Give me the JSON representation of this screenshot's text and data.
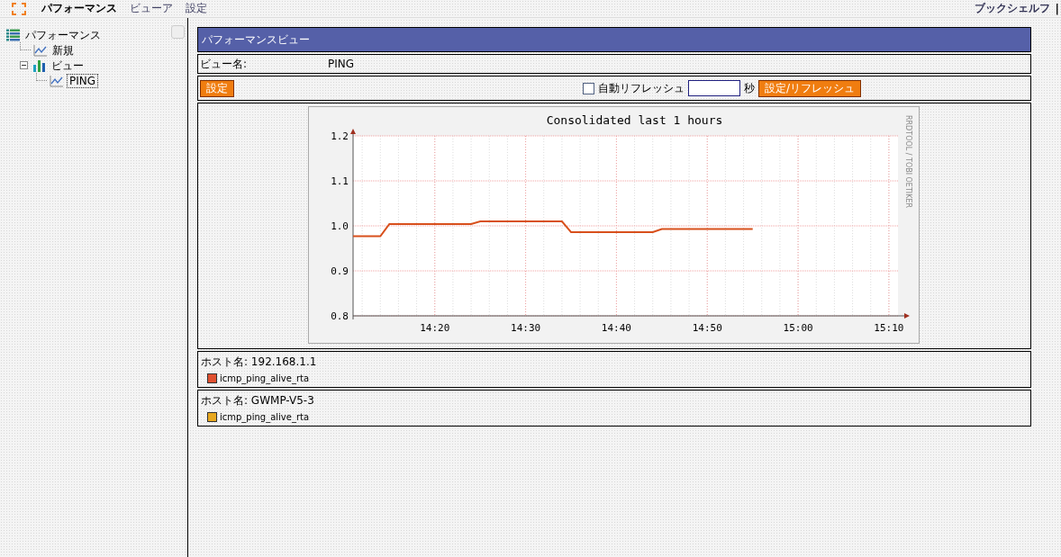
{
  "top_menu": {
    "items": [
      {
        "label": "パフォーマンス",
        "selected": true
      },
      {
        "label": "ビューア",
        "selected": false
      },
      {
        "label": "設定",
        "selected": false
      }
    ],
    "right_link": "ブックシェルフ",
    "separator": "|"
  },
  "sidebar": {
    "tree": [
      {
        "label": "パフォーマンス",
        "kind": "root",
        "selected": false,
        "children": [
          {
            "label": "新規",
            "kind": "view",
            "selected": false
          },
          {
            "label": "ビュー",
            "kind": "group",
            "expanded": true,
            "selected": false,
            "children": [
              {
                "label": "PING",
                "kind": "view",
                "selected": true
              }
            ]
          }
        ]
      }
    ]
  },
  "panel": {
    "title": "パフォーマンスビュー",
    "view_name_label": "ビュー名:",
    "view_name": "PING",
    "settings_button": "設定",
    "auto_refresh": {
      "label": "自動リフレッシュ",
      "checked": false,
      "unit": "秒"
    },
    "apply_button": "設定/リフレッシュ"
  },
  "chart": {
    "credit": "RRDTOOL / TOBI OETIKER",
    "chart_data": {
      "type": "line",
      "title": "Consolidated last 1 hours",
      "grid": true,
      "categories": [
        null,
        null,
        null,
        null,
        null,
        null,
        null,
        null,
        null,
        "14:20",
        null,
        null,
        null,
        null,
        null,
        null,
        null,
        null,
        null,
        "14:30",
        null,
        null,
        null,
        null,
        null,
        null,
        null,
        null,
        null,
        "14:40",
        null,
        null,
        null,
        null,
        null,
        null,
        null,
        null,
        null,
        "14:50",
        null,
        null,
        null,
        null,
        null,
        null,
        null,
        null,
        null,
        "15:00",
        null,
        null,
        null,
        null,
        null,
        null,
        null,
        null,
        null,
        "15:10",
        null
      ],
      "series": [
        {
          "color": "#d8501c",
          "values": [
            0.977,
            0.977,
            0.977,
            0.977,
            1.004,
            1.004,
            1.004,
            1.004,
            1.004,
            1.004,
            1.004,
            1.004,
            1.004,
            1.004,
            1.01,
            1.01,
            1.01,
            1.01,
            1.01,
            1.01,
            1.01,
            1.01,
            1.01,
            1.01,
            0.986,
            0.986,
            0.986,
            0.986,
            0.986,
            0.986,
            0.986,
            0.986,
            0.986,
            0.986,
            0.993,
            0.993,
            0.993,
            0.993,
            0.993,
            0.993,
            0.993,
            0.993,
            0.993,
            0.993,
            0.993,
            null,
            null,
            null,
            null,
            null,
            null,
            null,
            null,
            null,
            null,
            null,
            null,
            null,
            null,
            null,
            null
          ]
        }
      ],
      "ylim": [
        0.8,
        1.2
      ],
      "yticks": [
        {
          "value": 0.8,
          "label": "0.8"
        },
        {
          "value": 0.9,
          "label": "0.9"
        },
        {
          "value": 1.0,
          "label": "1.0"
        },
        {
          "value": 1.1,
          "label": "1.1"
        },
        {
          "value": 1.2,
          "label": "1.2"
        }
      ]
    }
  },
  "hosts": [
    {
      "label": "ホスト名: 192.168.1.1",
      "metrics": [
        {
          "name": "icmp_ping_alive_rta",
          "color": "#e05030"
        }
      ]
    },
    {
      "label": "ホスト名: GWMP-V5-3",
      "metrics": [
        {
          "name": "icmp_ping_alive_rta",
          "color": "#e8a820"
        }
      ]
    }
  ]
}
